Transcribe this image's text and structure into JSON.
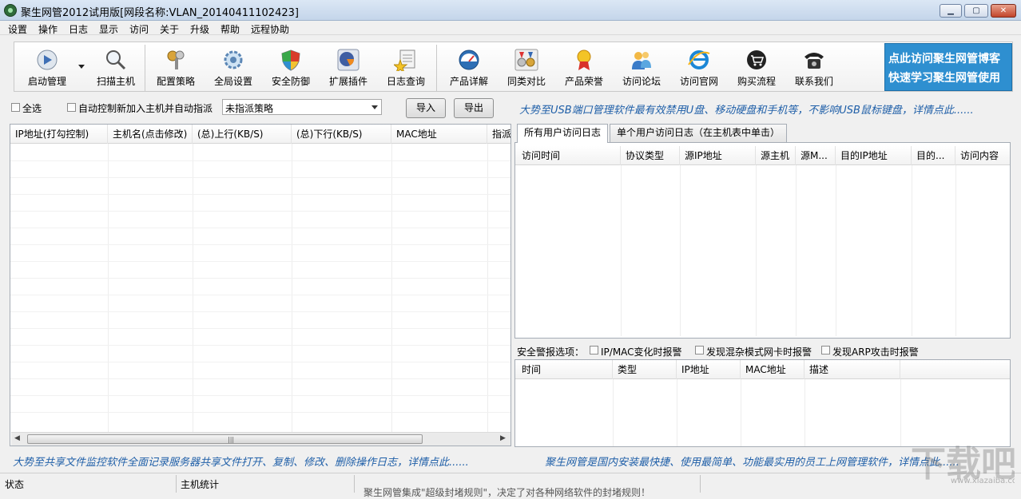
{
  "window": {
    "title": "聚生网管2012试用版[网段名称:VLAN_20140411102423]",
    "min_label": "▁",
    "max_label": "▢",
    "close_label": "✕"
  },
  "menu": [
    "设置",
    "操作",
    "日志",
    "显示",
    "访问",
    "关于",
    "升级",
    "帮助",
    "远程协助"
  ],
  "toolbar": {
    "items": [
      {
        "label": "启动管理",
        "icon": "play-icon"
      },
      {
        "label": "扫描主机",
        "icon": "magnifier-icon"
      },
      {
        "label": "配置策略",
        "icon": "keys-icon"
      },
      {
        "label": "全局设置",
        "icon": "gear-icon"
      },
      {
        "label": "安全防御",
        "icon": "shield-icon"
      },
      {
        "label": "扩展插件",
        "icon": "plugin-icon"
      },
      {
        "label": "日志查询",
        "icon": "log-icon"
      },
      {
        "label": "产品详解",
        "icon": "gauge-icon"
      },
      {
        "label": "同类对比",
        "icon": "medals-icon"
      },
      {
        "label": "产品荣誉",
        "icon": "award-icon"
      },
      {
        "label": "访问论坛",
        "icon": "users-icon"
      },
      {
        "label": "访问官网",
        "icon": "browser-icon"
      },
      {
        "label": "购买流程",
        "icon": "cart-icon"
      },
      {
        "label": "联系我们",
        "icon": "phone-icon"
      }
    ],
    "promo_line1": "点此访问聚生网管博客",
    "promo_line2": "快速学习聚生网管使用"
  },
  "controls": {
    "select_all": "全选",
    "auto_control": "自动控制新加入主机并自动指派",
    "policy_value": "未指派策略",
    "import_label": "导入",
    "export_label": "导出"
  },
  "banners": {
    "top_right": "大势至USB端口管理软件最有效禁用U盘、移动硬盘和手机等，不影响USB鼠标键盘，详情点此......",
    "bottom_left": "大势至共享文件监控软件全面记录服务器共享文件打开、复制、修改、删除操作日志，详情点此......",
    "bottom_right": "聚生网管是国内安装最快捷、使用最简单、功能最实用的员工上网管理软件，详情点此......"
  },
  "host_table": {
    "columns": [
      "IP地址(打勾控制)",
      "主机名(点击修改)",
      "(总)上行(KB/S)",
      "(总)下行(KB/S)",
      "MAC地址",
      "指派"
    ]
  },
  "tabs": [
    "所有用户访问日志",
    "单个用户访问日志（在主机表中单击）"
  ],
  "access_log": {
    "columns": [
      "访问时间",
      "协议类型",
      "源IP地址",
      "源主机",
      "源M...",
      "目的IP地址",
      "目的...",
      "访问内容"
    ]
  },
  "alarm": {
    "label": "安全警报选项：",
    "options": [
      "IP/MAC变化时报警",
      "发现混杂模式网卡时报警",
      "发现ARP攻击时报警"
    ],
    "columns": [
      "时间",
      "类型",
      "IP地址",
      "MAC地址",
      "描述"
    ]
  },
  "status": {
    "state": "状态",
    "host_stats": "主机统计",
    "message": "聚生网管集成\"超级封堵规则\"，决定了对各种网络软件的封堵规则！"
  },
  "watermark": {
    "text": "下载吧",
    "small": "www.xiazaiba.com"
  },
  "colors": {
    "banner": "#1f5fa8",
    "promo_bg": "#2e8fd0"
  }
}
